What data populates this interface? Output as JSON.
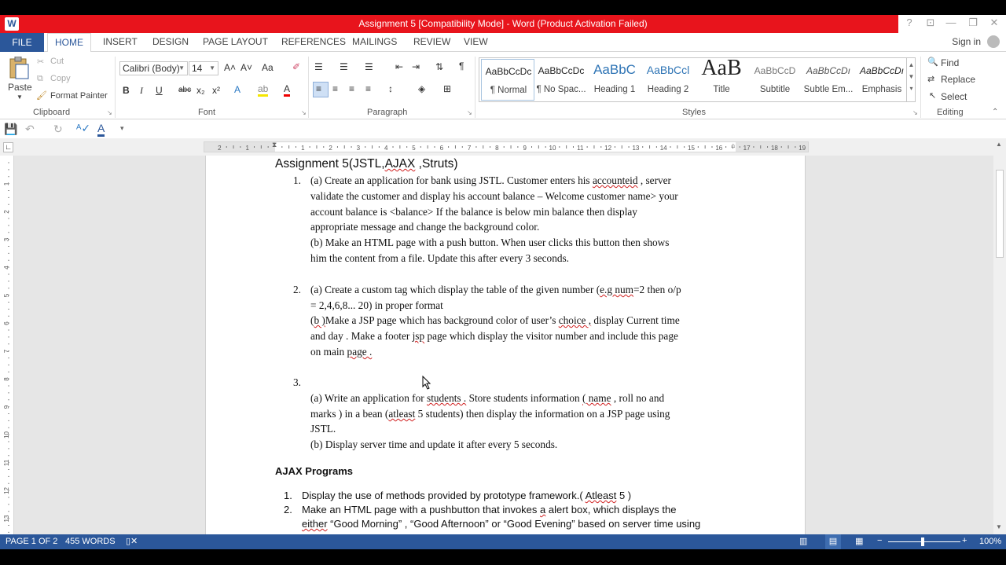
{
  "window": {
    "app_icon": "W",
    "title": "Assignment 5 [Compatibility Mode] -  Word (Product Activation Failed)",
    "help_glyph": "?",
    "restore_ribbon_glyph": "⊡",
    "minimize_glyph": "—",
    "maximize_glyph": "❐",
    "close_glyph": "✕"
  },
  "tabs": [
    "FILE",
    "HOME",
    "INSERT",
    "DESIGN",
    "PAGE LAYOUT",
    "REFERENCES",
    "MAILINGS",
    "REVIEW",
    "VIEW"
  ],
  "signin": "Sign in",
  "clipboard": {
    "paste": "Paste",
    "cut": "Cut",
    "copy": "Copy",
    "format_painter": "Format Painter",
    "label": "Clipboard"
  },
  "font": {
    "family": "Calibri (Body)",
    "size": "14",
    "label": "Font",
    "grow": "A˄",
    "shrink": "A˅",
    "case": "Aa",
    "bold": "B",
    "italic": "I",
    "underline": "U",
    "strike": "abc",
    "sub": "x₂",
    "sup": "x²"
  },
  "paragraph": {
    "label": "Paragraph",
    "pilcrow": "¶"
  },
  "styles": {
    "label": "Styles",
    "items": [
      {
        "preview": "AaBbCcDc",
        "name": "¶ Normal"
      },
      {
        "preview": "AaBbCcDc",
        "name": "¶ No Spac..."
      },
      {
        "preview": "AaBbC",
        "name": "Heading 1"
      },
      {
        "preview": "AaBbCcl",
        "name": "Heading 2"
      },
      {
        "preview": "AaB",
        "name": "Title"
      },
      {
        "preview": "AaBbCcD",
        "name": "Subtitle"
      },
      {
        "preview": "AaBbCcDı",
        "name": "Subtle Em..."
      },
      {
        "preview": "AaBbCcDı",
        "name": "Emphasis"
      }
    ]
  },
  "editing": {
    "find": "Find",
    "replace": "Replace",
    "select": "Select",
    "label": "Editing"
  },
  "ruler": {
    "h_labels": [
      "2",
      "1",
      "1",
      "2",
      "3",
      "4",
      "5",
      "6",
      "7",
      "8",
      "9",
      "10",
      "11",
      "12",
      "13",
      "14",
      "15",
      "16",
      "17",
      "18",
      "19"
    ],
    "v_labels": [
      "1",
      "2",
      "3",
      "4",
      "5",
      "6",
      "7",
      "8",
      "9",
      "10",
      "11",
      "12",
      "13"
    ]
  },
  "document": {
    "heading": {
      "a": "Assignment 5(JSTL,",
      "b": "AJAX",
      "c": " ,Struts)"
    },
    "q1": {
      "num": "1.",
      "l1a": "(a) Create an application for bank using JSTL. Customer enters his ",
      "l1b": "accounteid",
      "l1c": "  , server",
      "l2": "validate the customer and display his account balance – Welcome customer name> your",
      "l3": "account balance is <balance> If the balance is below min balance then display",
      "l4": "appropriate message and change the background color.",
      "l5": "(b) Make an HTML page with a push button. When user clicks this button then shows",
      "l6": "him the content from a file. Update this after every 3 seconds."
    },
    "q2": {
      "num": "2.",
      "l1a": "(a) Create a custom tag which display the table of the given number (",
      "l1b": "e.g num",
      "l1c": "=2 then o/p",
      "l2": "= 2,4,6,8... 20) in proper format",
      "l3a": "(",
      "l3b": "b )",
      "l3c": "Make a JSP page which has background color of user’s ",
      "l3d": "choice ,",
      "l3e": " display Current time",
      "l4a": "and day . Make a footer ",
      "l4b": "jsp",
      "l4c": " page which display the visitor number and include this page",
      "l5a": "on main ",
      "l5b": "page .",
      "l5c": ""
    },
    "q3": {
      "num": "3.",
      "l1a": "(a) Write an application for ",
      "l1b": "students .",
      "l1c": " Store students information ",
      "l1d": "( name",
      "l1e": " , roll no and",
      "l2a": "marks ) in a bean (",
      "l2b": "atleast",
      "l2c": " 5 students) then display the information on a JSP page using",
      "l3": "JSTL.",
      "l4": "(b) Display server time and update it after every 5 seconds."
    },
    "ajax_heading": "AJAX Programs",
    "ajax": {
      "n1": "1.",
      "t1a": "Display the use of methods provided by prototype framework.( ",
      "t1b": "Atleast",
      "t1c": " 5 )",
      "n2": "2.",
      "t2a": "Make an HTML page with a pushbutton that invokes ",
      "t2b": "a",
      "t2c": " alert box, which displays the",
      "t3a": "either",
      "t3b": " “Good Morning” , “Good Afternoon” or  “Good Evening” based on server time using"
    }
  },
  "status": {
    "page": "PAGE 1 OF 2",
    "words": "455 WORDS",
    "zoom": "100%",
    "zoom_minus": "−",
    "zoom_plus": "+"
  }
}
